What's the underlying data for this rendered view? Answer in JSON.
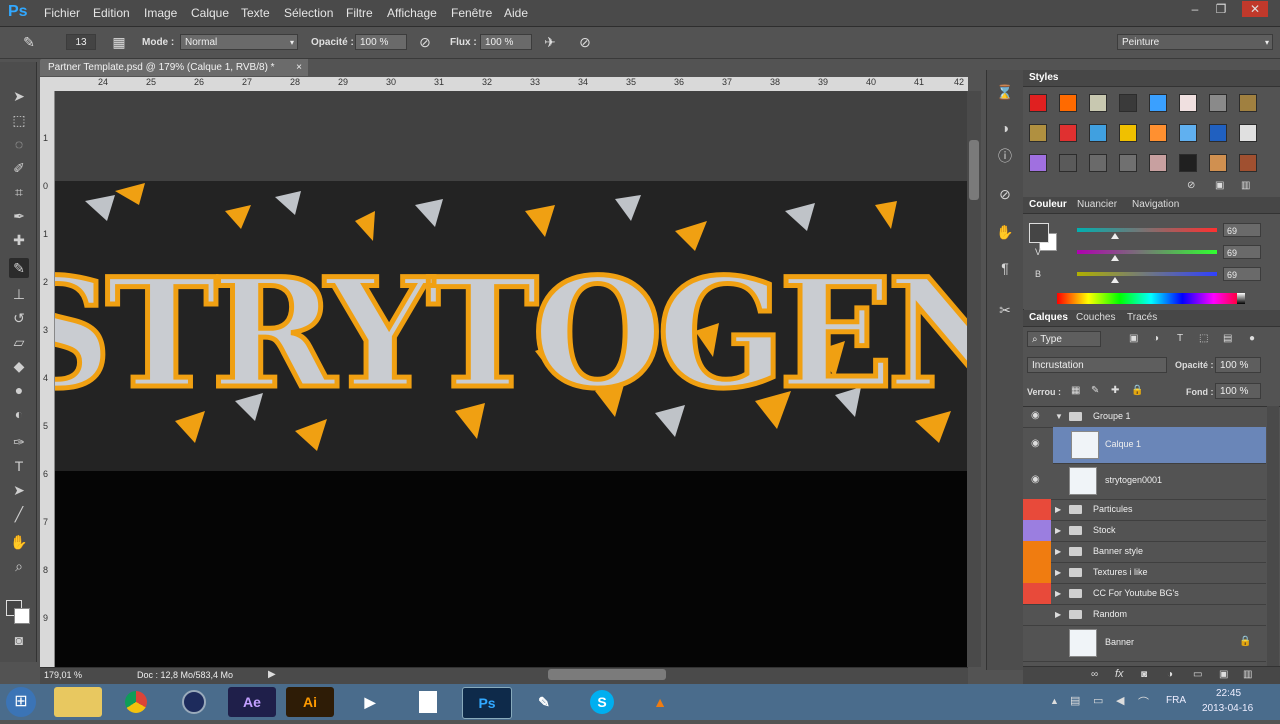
{
  "menubar": {
    "logo": "Ps",
    "items": [
      "Fichier",
      "Edition",
      "Image",
      "Calque",
      "Texte",
      "Sélection",
      "Filtre",
      "Affichage",
      "Fenêtre",
      "Aide"
    ],
    "window_controls": [
      "–",
      "❐",
      "✕"
    ]
  },
  "options": {
    "brush_size": "13",
    "mode_label": "Mode :",
    "mode_value": "Normal",
    "opacity_label": "Opacité :",
    "opacity_value": "100 %",
    "flow_label": "Flux :",
    "flow_value": "100 %",
    "workspace": "Peinture"
  },
  "document": {
    "tab_title": "Partner Template.psd @ 179% (Calque 1, RVB/8) *",
    "tab_close": "×",
    "ruler_top": [
      "24",
      "25",
      "26",
      "27",
      "28",
      "29",
      "30",
      "31",
      "32",
      "33",
      "34",
      "35",
      "36",
      "37",
      "38",
      "39",
      "40",
      "41",
      "42"
    ],
    "ruler_left": [
      "1",
      "0",
      "1",
      "2",
      "3",
      "4",
      "5",
      "6",
      "7",
      "8",
      "9"
    ],
    "artwork_text": "STRYTOGEN",
    "zoom": "179,01 %",
    "doc_info": "Doc : 12,8 Mo/583,4 Mo"
  },
  "styles_panel": {
    "title": "Styles",
    "swatches": [
      "#e02020",
      "#ff6a00",
      "#c8c8b0",
      "#3a3a3a",
      "#3aa0ff",
      "#f0e0e0",
      "#8a8a8a",
      "#a08040",
      "#b09040",
      "#e03030",
      "#40a0e0",
      "#f0c000",
      "#ff9030",
      "#60b0f0",
      "#2060c0",
      "#e0e0e0",
      "#a070e0",
      "#5a5a5a",
      "#6a6a6a",
      "#707070",
      "#c8a0a0",
      "#202020",
      "#d09050",
      "#a05030"
    ]
  },
  "color_panel": {
    "tabs": [
      "Couleur",
      "Nuancier",
      "Navigation"
    ],
    "channels": [
      {
        "label": "R",
        "value": "69",
        "level": 0.27
      },
      {
        "label": "V",
        "value": "69",
        "level": 0.27
      },
      {
        "label": "B",
        "value": "69",
        "level": 0.27
      }
    ],
    "fg_color": "#454545",
    "bg_color": "#ffffff"
  },
  "layers_panel": {
    "tabs": [
      "Calques",
      "Couches",
      "Tracés"
    ],
    "filter_kind": "Type",
    "blend_mode": "Incrustation",
    "opacity_label": "Opacité :",
    "opacity_value": "100 %",
    "lock_label": "Verrou :",
    "fill_label": "Fond :",
    "fill_value": "100 %",
    "layers": [
      {
        "name": "Groupe 1",
        "type": "group",
        "open": true,
        "visible": true,
        "color": ""
      },
      {
        "name": "Calque 1",
        "type": "layer",
        "selected": true,
        "visible": true,
        "color": ""
      },
      {
        "name": "strytogen0001",
        "type": "layer",
        "visible": true,
        "color": ""
      },
      {
        "name": "Particules",
        "type": "group",
        "visible": false,
        "color": "#e84a3a"
      },
      {
        "name": "Stock",
        "type": "group",
        "visible": false,
        "color": "#9b7ee0"
      },
      {
        "name": "Banner style",
        "type": "group",
        "visible": false,
        "color": "#f07c10"
      },
      {
        "name": "Textures i like",
        "type": "group",
        "visible": false,
        "color": "#f07c10"
      },
      {
        "name": "CC For Youtube BG's",
        "type": "group",
        "visible": false,
        "color": "#e84a3a"
      },
      {
        "name": "Random",
        "type": "group",
        "visible": false,
        "color": ""
      },
      {
        "name": "Banner",
        "type": "layer",
        "visible": false,
        "locked": true,
        "color": ""
      }
    ]
  },
  "taskbar": {
    "apps": [
      "Ae",
      "Ai",
      "Ps"
    ],
    "lang": "FRA",
    "time": "22:45",
    "date": "2013-04-16"
  }
}
